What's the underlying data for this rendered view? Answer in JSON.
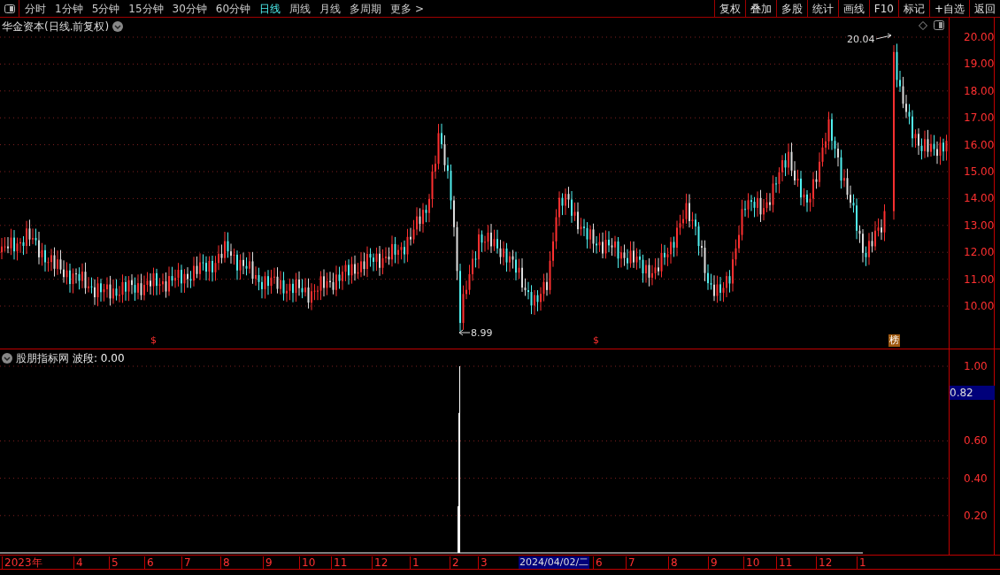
{
  "toolbar": {
    "periods": [
      {
        "label": "分时",
        "selected": false
      },
      {
        "label": "1分钟",
        "selected": false
      },
      {
        "label": "5分钟",
        "selected": false
      },
      {
        "label": "15分钟",
        "selected": false
      },
      {
        "label": "30分钟",
        "selected": false
      },
      {
        "label": "60分钟",
        "selected": false
      },
      {
        "label": "日线",
        "selected": true
      },
      {
        "label": "周线",
        "selected": false
      },
      {
        "label": "月线",
        "selected": false
      },
      {
        "label": "多周期",
        "selected": false
      },
      {
        "label": "更多 >",
        "selected": false
      }
    ],
    "buttons": [
      "复权",
      "叠加",
      "多股",
      "统计",
      "画线",
      "F10",
      "标记",
      "+自选",
      "返回"
    ]
  },
  "main_chart": {
    "title": "华金资本(日线.前复权)",
    "high_label": "20.04",
    "low_label": "8.99",
    "markers": [
      {
        "kind": "sign",
        "text": "$"
      },
      {
        "kind": "sign",
        "text": "$"
      },
      {
        "kind": "badge",
        "text": "榜"
      }
    ],
    "y_axis": [
      "20.00",
      "19.00",
      "18.00",
      "17.00",
      "16.00",
      "15.00",
      "14.00",
      "13.00",
      "12.00",
      "11.00",
      "10.00"
    ]
  },
  "indicator": {
    "name": "股朋指标网",
    "reading": "波段: 0.00",
    "cursor_value": "0.82",
    "y_axis": [
      "1.00",
      "0.60",
      "0.40",
      "0.20"
    ]
  },
  "date_axis": [
    {
      "label": "2023年",
      "selected": false
    },
    {
      "label": "4",
      "selected": false
    },
    {
      "label": "5",
      "selected": false
    },
    {
      "label": "6",
      "selected": false
    },
    {
      "label": "7",
      "selected": false
    },
    {
      "label": "8",
      "selected": false
    },
    {
      "label": "9",
      "selected": false
    },
    {
      "label": "10",
      "selected": false
    },
    {
      "label": "11",
      "selected": false
    },
    {
      "label": "12",
      "selected": false
    },
    {
      "label": "1",
      "selected": false
    },
    {
      "label": "2",
      "selected": false
    },
    {
      "label": "3",
      "selected": false
    },
    {
      "label": "2024/04/02/二",
      "selected": true
    },
    {
      "label": "6",
      "selected": false
    },
    {
      "label": "7",
      "selected": false
    },
    {
      "label": "8",
      "selected": false
    },
    {
      "label": "9",
      "selected": false
    },
    {
      "label": "10",
      "selected": false
    },
    {
      "label": "11",
      "selected": false
    },
    {
      "label": "12",
      "selected": false
    },
    {
      "label": "1",
      "selected": false
    }
  ]
}
